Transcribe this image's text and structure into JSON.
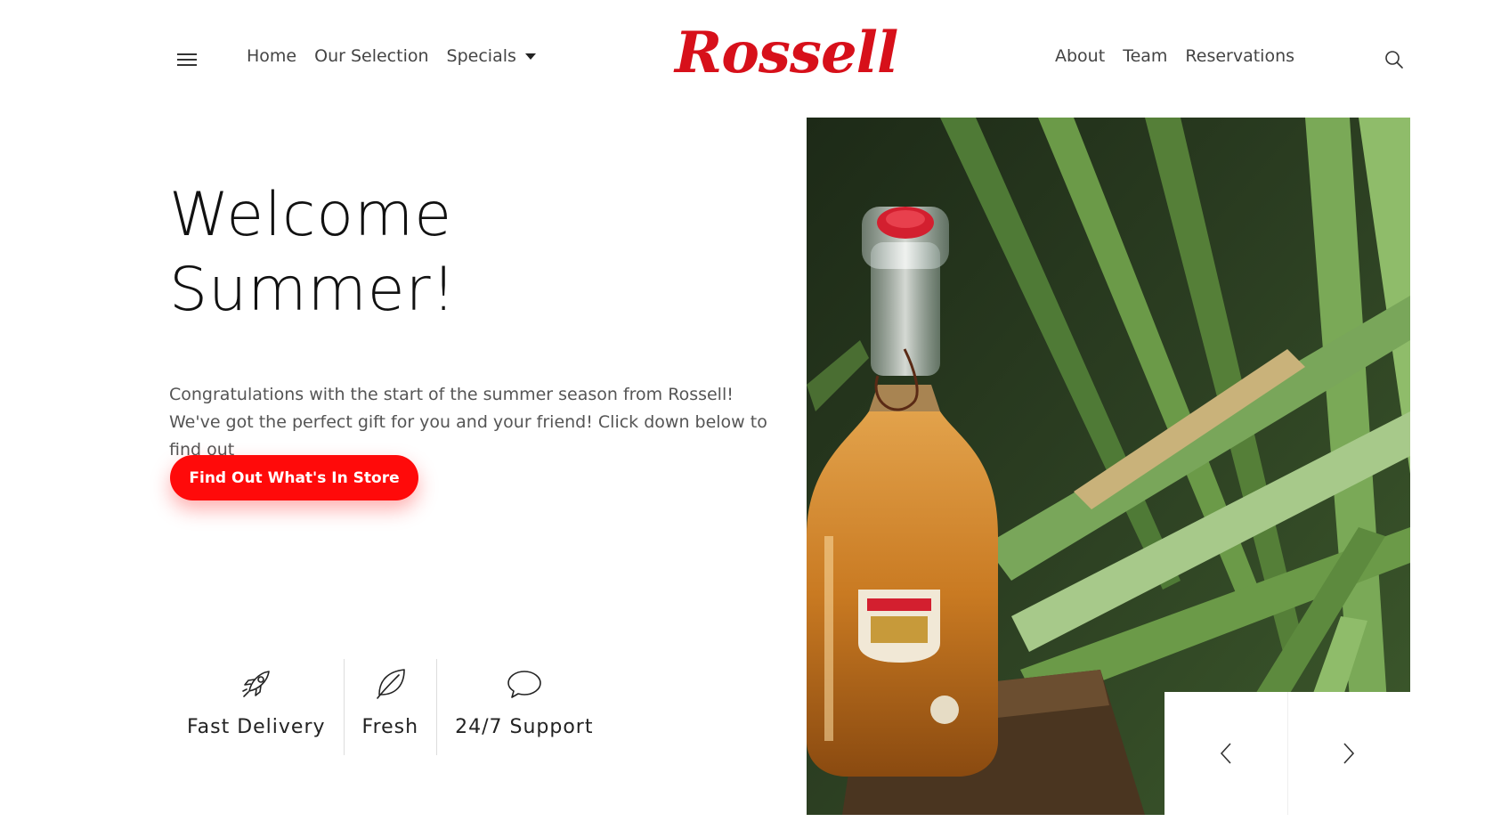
{
  "header": {
    "logo": "Rossell",
    "nav_left": [
      "Home",
      "Our Selection",
      "Specials"
    ],
    "nav_right": [
      "About",
      "Team",
      "Reservations"
    ]
  },
  "hero": {
    "title_line1": "Welcome",
    "title_line2": "Summer!",
    "description": "Congratulations with the start of the summer season from Rossell! We've got the perfect gift for you and your friend! Click down below to find out",
    "cta_label": "Find Out What's In Store"
  },
  "features": [
    {
      "label": "Fast Delivery",
      "icon": "rocket-icon"
    },
    {
      "label": "Fresh",
      "icon": "leaf-icon"
    },
    {
      "label": "24/7 Support",
      "icon": "chat-bubble-icon"
    }
  ],
  "colors": {
    "brand_red": "#d7101a",
    "button_red": "#ff0a0a"
  },
  "icons": {
    "menu": "hamburger-icon",
    "search": "search-icon",
    "slider_prev": "chevron-left-icon",
    "slider_next": "chevron-right-icon"
  }
}
